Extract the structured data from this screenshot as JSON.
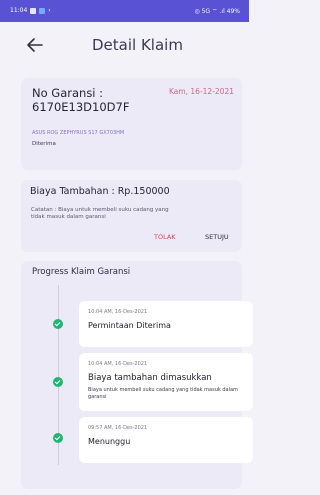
{
  "status_bar": {
    "time": "11:04",
    "right_text": "◎ 5G ⌔ .ıl 49%"
  },
  "header": {
    "title": "Detail Klaim"
  },
  "claim": {
    "number_label": "No Garansi :",
    "number": "6170E13D10D7F",
    "date": "Kam, 16-12-2021",
    "device": "ASUS ROG ZEPHYRUS S17 GX703HM",
    "status": "Diterima"
  },
  "extra_cost": {
    "title": "Biaya Tambahan : Rp.150000",
    "note": "Catatan : Biaya untuk membeli suku cadang yang tidak masuk dalam garansi",
    "reject_label": "TOLAK",
    "approve_label": "SETUJU"
  },
  "progress": {
    "title": "Progress Klaim Garansi",
    "steps": [
      {
        "time": "10:04 AM, 16-Des-2021",
        "title": "Permintaan Diterima",
        "desc": ""
      },
      {
        "time": "10:04 AM, 16-Des-2021",
        "title": "Biaya tambahan dimasukkan",
        "desc": "Biaya untuk membeli suku cadang yang tidak masuk dalam garansi"
      },
      {
        "time": "09:57 AM, 16-Des-2021",
        "title": "Menunggu",
        "desc": ""
      }
    ]
  },
  "colors": {
    "accent": "#5a52d5",
    "success": "#21b573",
    "reject": "#d2445b",
    "date": "#c76b86"
  }
}
